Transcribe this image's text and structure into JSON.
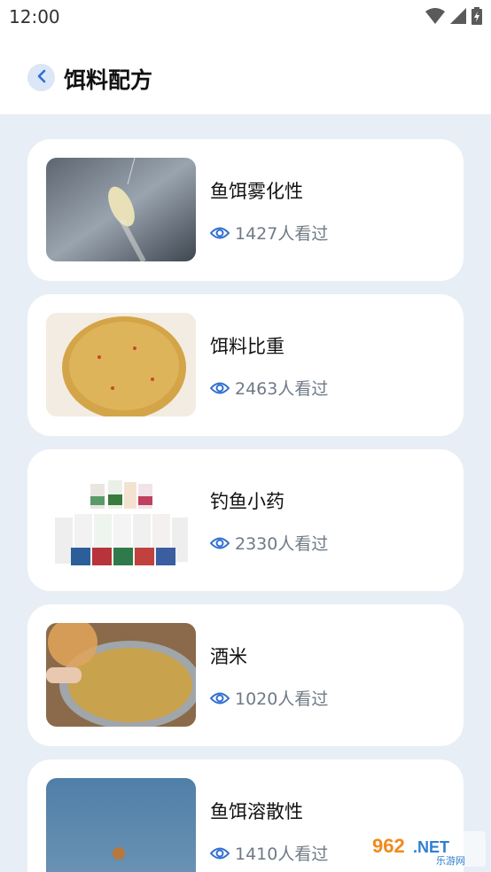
{
  "status_bar": {
    "time": "12:00"
  },
  "header": {
    "title": "饵料配方"
  },
  "colors": {
    "accent": "#2f6fd1",
    "page_bg": "#e7eef6",
    "card_bg": "#ffffff"
  },
  "items": [
    {
      "title": "鱼饵雾化性",
      "views": "1427人看过"
    },
    {
      "title": "饵料比重",
      "views": "2463人看过"
    },
    {
      "title": "钓鱼小药",
      "views": "2330人看过"
    },
    {
      "title": "酒米",
      "views": "1020人看过"
    },
    {
      "title": "鱼饵溶散性",
      "views": "1410人看过"
    }
  ],
  "watermark": {
    "brand": "962.NET",
    "sub": "乐游网"
  }
}
